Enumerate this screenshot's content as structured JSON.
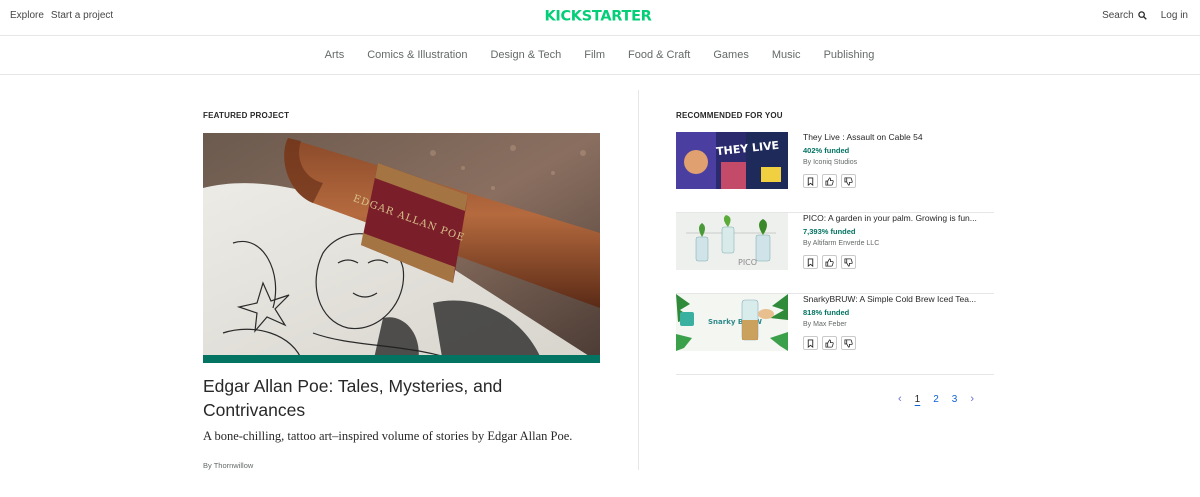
{
  "header": {
    "explore": "Explore",
    "start_project": "Start a project",
    "logo_text": "KICKSTARTER",
    "search": "Search",
    "login": "Log in"
  },
  "categories": [
    "Arts",
    "Comics & Illustration",
    "Design & Tech",
    "Film",
    "Food & Craft",
    "Games",
    "Music",
    "Publishing"
  ],
  "featured": {
    "label": "FEATURED PROJECT",
    "title": "Edgar Allan Poe: Tales, Mysteries, and Contrivances",
    "blurb": "A bone-chilling, tattoo art–inspired volume of stories by Edgar Allan Poe.",
    "by": "By Thornwillow",
    "image_spine_text": "EDGAR ALLAN POE"
  },
  "recommended": {
    "label": "RECOMMENDED FOR YOU",
    "items": [
      {
        "title": "They Live : Assault on Cable 54",
        "funded": "402% funded",
        "by": "By Iconiq Studios",
        "thumb_text": "THEY LIVE"
      },
      {
        "title": "PICO: A garden in your palm. Growing is fun...",
        "funded": "7,393% funded",
        "by": "By Altifarm Enverde LLC",
        "thumb_text": "PICO"
      },
      {
        "title": "SnarkyBRUW: A Simple Cold Brew Iced Tea...",
        "funded": "818% funded",
        "by": "By Max Feber",
        "thumb_text": "Snarky BRUW"
      }
    ]
  },
  "pagination": {
    "prev": "‹",
    "pages": [
      "1",
      "2",
      "3"
    ],
    "next": "›",
    "current": "1"
  },
  "colors": {
    "brand": "#05ce78",
    "funded": "#037362",
    "link": "#0f62d6",
    "featured_bar": "#037362"
  },
  "icons": [
    "search-icon",
    "bookmark-icon",
    "thumbs-up-icon",
    "thumbs-down-icon"
  ]
}
